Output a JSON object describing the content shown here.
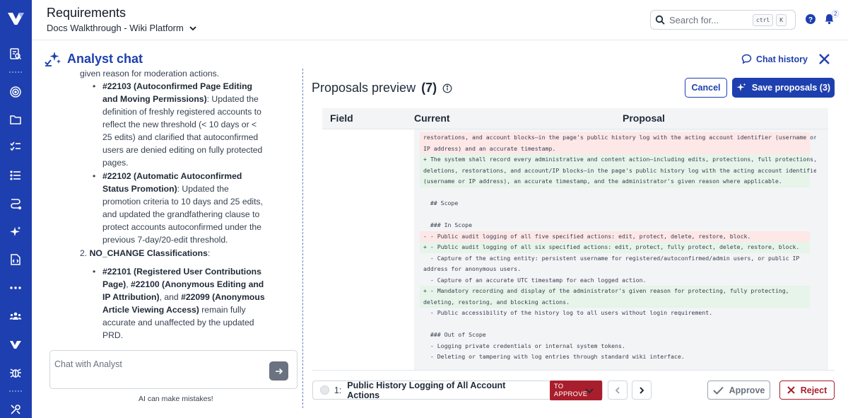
{
  "header": {
    "title": "Requirements",
    "breadcrumb": "Docs Walkthrough - Wiki Platform",
    "search_placeholder": "Search for...",
    "kbd_ctrl": "ctrl",
    "kbd_k": "K",
    "notification_count": "2"
  },
  "sidebar": {
    "icons": [
      "document-search-icon",
      "target-icon",
      "folder-icon",
      "checklist-icon",
      "list-icon",
      "flow-icon",
      "sparkle-icon",
      "file-code-icon",
      "more-icon",
      "team-icon",
      "brand-icon",
      "bug-icon",
      "tools-icon"
    ]
  },
  "chat": {
    "title": "Analyst chat",
    "history_label": "Chat history",
    "input_placeholder": "Chat with Analyst",
    "disclaimer": "AI can make mistakes!",
    "messages": {
      "line0": "given reason for moderation actions.",
      "i1_bold": "#22103 (Autoconfirmed Page Editing and Moving Permissions)",
      "i1_text": ": Updated the definition of freshly registered accounts to reflect the new threshold (< 10 days or < 25 edits) and clarified that autoconfirmed users are denied editing on fully protected pages.",
      "i2_bold": "#22102 (Automatic Autoconfirmed Status Promotion)",
      "i2_text": ": Updated the promotion criteria to 10 days and 25 edits, and updated the grandfathering clause to protect accounts autoconfirmed under the previous 7-day/20-edit threshold.",
      "sec2_num": "2.",
      "sec2_bold": "NO_CHANGE Classifications",
      "sec2_colon": ":",
      "i3_b1": "#22101 (Registered User Contributions Page)",
      "i3_t1": ", ",
      "i3_b2": "#22100 (Anonymous Editing and IP Attribution)",
      "i3_t2": ", and ",
      "i3_b3": "#22099 (Anonymous Article Viewing Access)",
      "i3_t3": " remain fully accurate and unaffected by the updated PRD."
    }
  },
  "proposals": {
    "title": "Proposals preview",
    "count": "(7)",
    "cancel_label": "Cancel",
    "save_label": "Save proposals (3)",
    "columns": [
      "Field",
      "Current",
      "Proposal"
    ],
    "diff": [
      {
        "kind": "del",
        "text": "restorations, and account blocks—in the page's public history log with the acting account identifier (username or"
      },
      {
        "kind": "del",
        "text": "IP address) and an accurate timestamp."
      },
      {
        "kind": "add",
        "text": "+ The system shall record every administrative and content action—including edits, protections, full protections,"
      },
      {
        "kind": "add",
        "text": "deletions, restorations, and account/IP blocks—in the page's public history log with the acting account identifier"
      },
      {
        "kind": "add",
        "text": "(username or IP address), an accurate timestamp, and the administrator's given reason where applicable."
      },
      {
        "kind": "ctx",
        "text": ""
      },
      {
        "kind": "ctx",
        "text": "  ## Scope"
      },
      {
        "kind": "ctx",
        "text": ""
      },
      {
        "kind": "ctx",
        "text": "  ### In Scope"
      },
      {
        "kind": "del",
        "text": "- - Public audit logging of all five specified actions: edit, protect, delete, restore, block."
      },
      {
        "kind": "add",
        "text": "+ - Public audit logging of all six specified actions: edit, protect, fully protect, delete, restore, block."
      },
      {
        "kind": "ctx",
        "text": "  - Capture of the acting entity: persistent username for registered/autoconfirmed/admin users, or public IP"
      },
      {
        "kind": "ctx",
        "text": "address for anonymous users."
      },
      {
        "kind": "ctx",
        "text": "  - Capture of an accurate UTC timestamp for each logged action."
      },
      {
        "kind": "add",
        "text": "+ - Mandatory recording and display of the administrator's given reason for protecting, fully protecting,"
      },
      {
        "kind": "add",
        "text": "deleting, restoring, and blocking actions."
      },
      {
        "kind": "ctx",
        "text": "  - Public accessibility of the history log to all users without login requirement."
      },
      {
        "kind": "ctx",
        "text": ""
      },
      {
        "kind": "ctx",
        "text": "  ### Out of Scope"
      },
      {
        "kind": "ctx",
        "text": "  - Logging private credentials or internal system tokens."
      },
      {
        "kind": "ctx",
        "text": "  - Deleting or tampering with log entries through standard wiki interface."
      }
    ],
    "footer": {
      "item_number": "1:",
      "item_name": "Public History Logging of All Account Actions",
      "status": "TO APPROVE",
      "approve_label": "Approve",
      "reject_label": "Reject"
    }
  },
  "colors": {
    "brand": "#1e3faf",
    "reject": "#a91e2c",
    "diff_removed": "#fde7e7",
    "diff_added": "#e6f4e9"
  }
}
